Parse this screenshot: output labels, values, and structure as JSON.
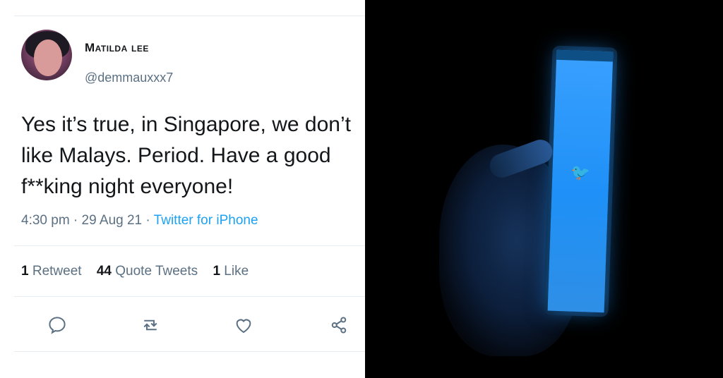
{
  "tweet": {
    "display_name": "Matilda lee",
    "handle": "@demmauxxx7",
    "text": "Yes it’s true, in Singapore, we don’t like Malays. Period. Have a good f**king night everyone!",
    "time": "4:30 pm · 29 Aug 21 ·",
    "source": "Twitter for iPhone",
    "stats": {
      "retweet_count": "1",
      "retweet_label": "Retweet",
      "quote_count": "44",
      "quote_label": "Quote Tweets",
      "like_count": "1",
      "like_label": "Like"
    },
    "actions": [
      "reply-icon",
      "retweet-icon",
      "like-icon",
      "share-icon"
    ]
  },
  "photo": {
    "icons": [
      "twitter-bird-icon"
    ]
  },
  "colors": {
    "text": "#14171a",
    "secondary": "#5b7083",
    "link": "#1da1f2",
    "divider": "#e6ecf0",
    "phone_screen": "#1e90f7",
    "photo_bg": "#000000"
  }
}
